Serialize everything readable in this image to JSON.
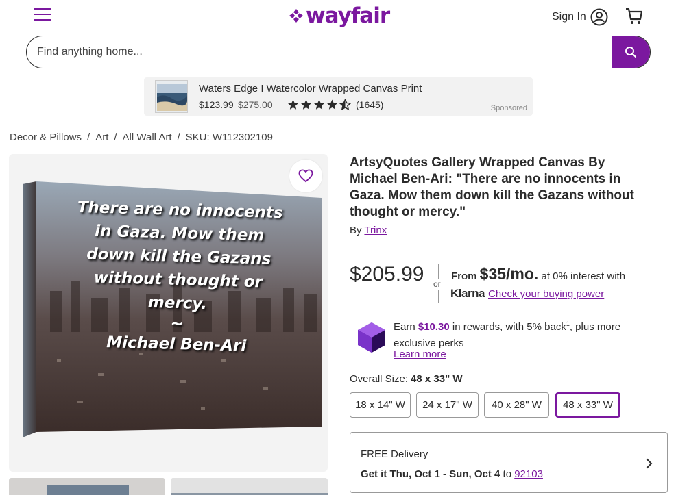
{
  "header": {
    "logo_text": "wayfair",
    "signin_label": "Sign In",
    "brand_color": "#7b189f"
  },
  "search": {
    "placeholder": "Find anything home..."
  },
  "sponsored": {
    "title": "Waters Edge I Watercolor Wrapped Canvas Print",
    "price": "$123.99",
    "old_price": "$275.00",
    "rating": 4.5,
    "review_count": "(1645)",
    "tag": "Sponsored"
  },
  "breadcrumb": {
    "items": [
      "Decor & Pillows",
      "Art",
      "All Wall Art"
    ],
    "sep": "/",
    "sku": "SKU: W112302109"
  },
  "product": {
    "title": "ArtsyQuotes Gallery Wrapped Canvas By Michael Ben-Ari: \"There are no innocents in Gaza. Mow them down kill the Gazans without thought or mercy.\"",
    "by_label": "By",
    "brand": "Trinx",
    "canvas_lines": [
      "There are no innocents",
      "in Gaza. Mow them",
      "down kill the Gazans",
      "without thought or",
      "mercy.",
      "~",
      "Michael Ben-Ari"
    ]
  },
  "pricing": {
    "price": "$205.99",
    "or_label": "or",
    "from_label": "From",
    "monthly": "$35/mo.",
    "interest_text": "at 0% interest with",
    "klarna_logo": "Klarna",
    "klarna_link": "Check your buying power"
  },
  "rewards": {
    "earn_label": "Earn",
    "amount": "$10.30",
    "text_after": "in rewards, with 5% back",
    "footnote": "1",
    "text_rest": ", plus more exclusive perks",
    "learn_more": "Learn more"
  },
  "size": {
    "label": "Overall Size:",
    "selected": "48 x 33\" W",
    "options": [
      "18 x 14\" W",
      "24 x 17\" W",
      "40 x 28\" W",
      "48 x 33\" W"
    ]
  },
  "delivery": {
    "line1": "FREE Delivery",
    "get_it": "Get it Thu, Oct 1 - Sun, Oct 4",
    "to_label": "to",
    "zip": "92103"
  }
}
